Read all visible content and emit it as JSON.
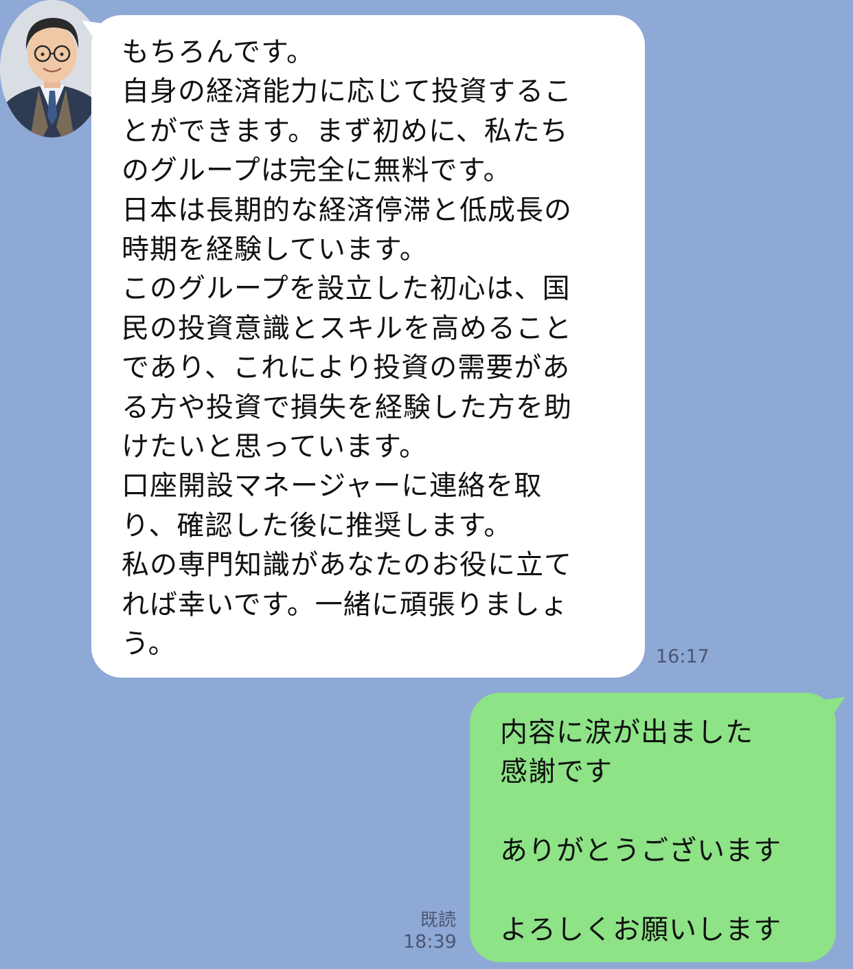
{
  "conversation": {
    "background_color": "#8fa9d6",
    "incoming": {
      "avatar": "businessman-avatar",
      "text": "もちろんです。\n自身の経済能力に応じて投資するこ\nとができます。まず初めに、私たち\nのグループは完全に無料です。\n日本は長期的な経済停滞と低成長の\n時期を経験しています。\nこのグループを設立した初心は、国\n民の投資意識とスキルを高めること\nであり、これにより投資の需要があ\nる方や投資で損失を経験した方を助\nけたいと思っています。\n口座開設マネージャーに連絡を取\nり、確認した後に推奨します。\n私の専門知識があなたのお役に立て\nれば幸いです。一緒に頑張りましょ\nう。",
      "time": "16:17",
      "bubble_color": "#ffffff"
    },
    "outgoing": {
      "text": "内容に涙が出ました\n感謝です\n\nありがとうございます\n\nよろしくお願いします",
      "read_status": "既読",
      "time": "18:39",
      "bubble_color": "#8de386"
    }
  }
}
